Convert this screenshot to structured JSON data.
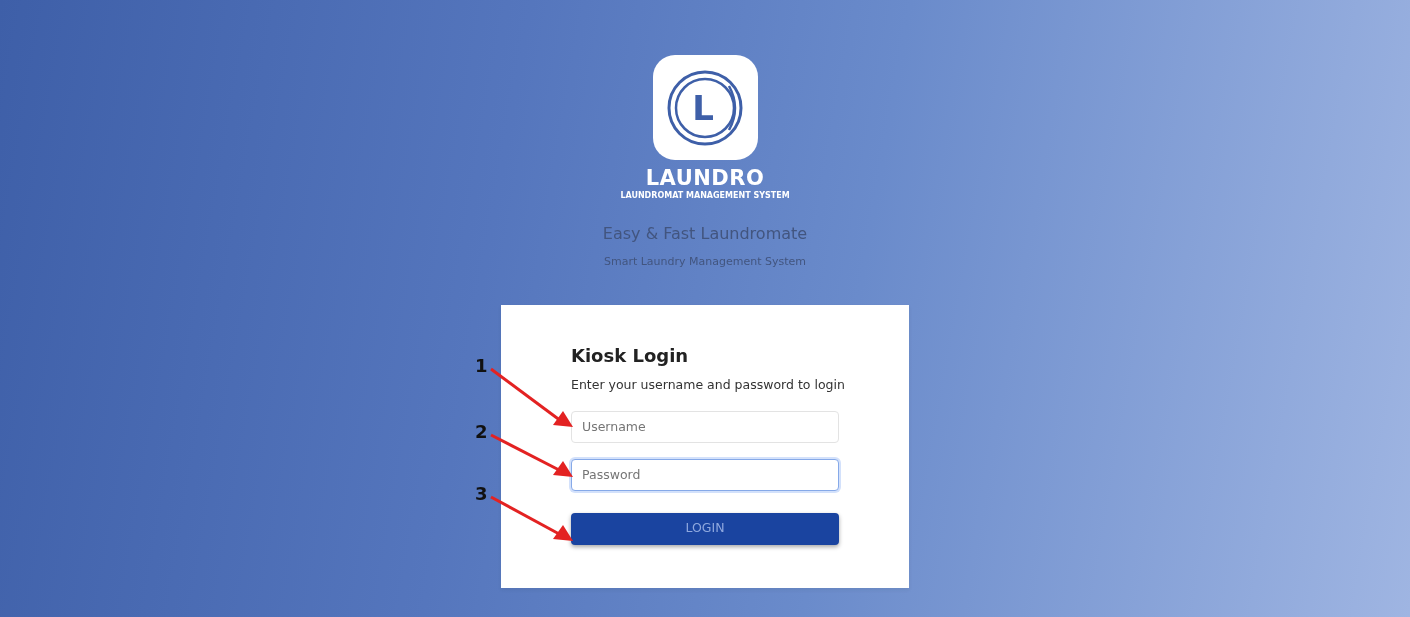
{
  "logo": {
    "letter": "L",
    "wordmark": "LAUNDRO",
    "tagline": "LAUNDROMAT MANAGEMENT SYSTEM"
  },
  "headline": "Easy & Fast Laundromate",
  "subheadline": "Smart Laundry Management System",
  "login_card": {
    "title": "Kiosk Login",
    "instructions": "Enter your username and password to login",
    "fields": [
      {
        "placeholder": "Username",
        "focused": false
      },
      {
        "placeholder": "Password",
        "focused": true
      }
    ],
    "button": "LOGIN"
  },
  "annotations": [
    {
      "label": "1"
    },
    {
      "label": "2"
    },
    {
      "label": "3"
    }
  ]
}
